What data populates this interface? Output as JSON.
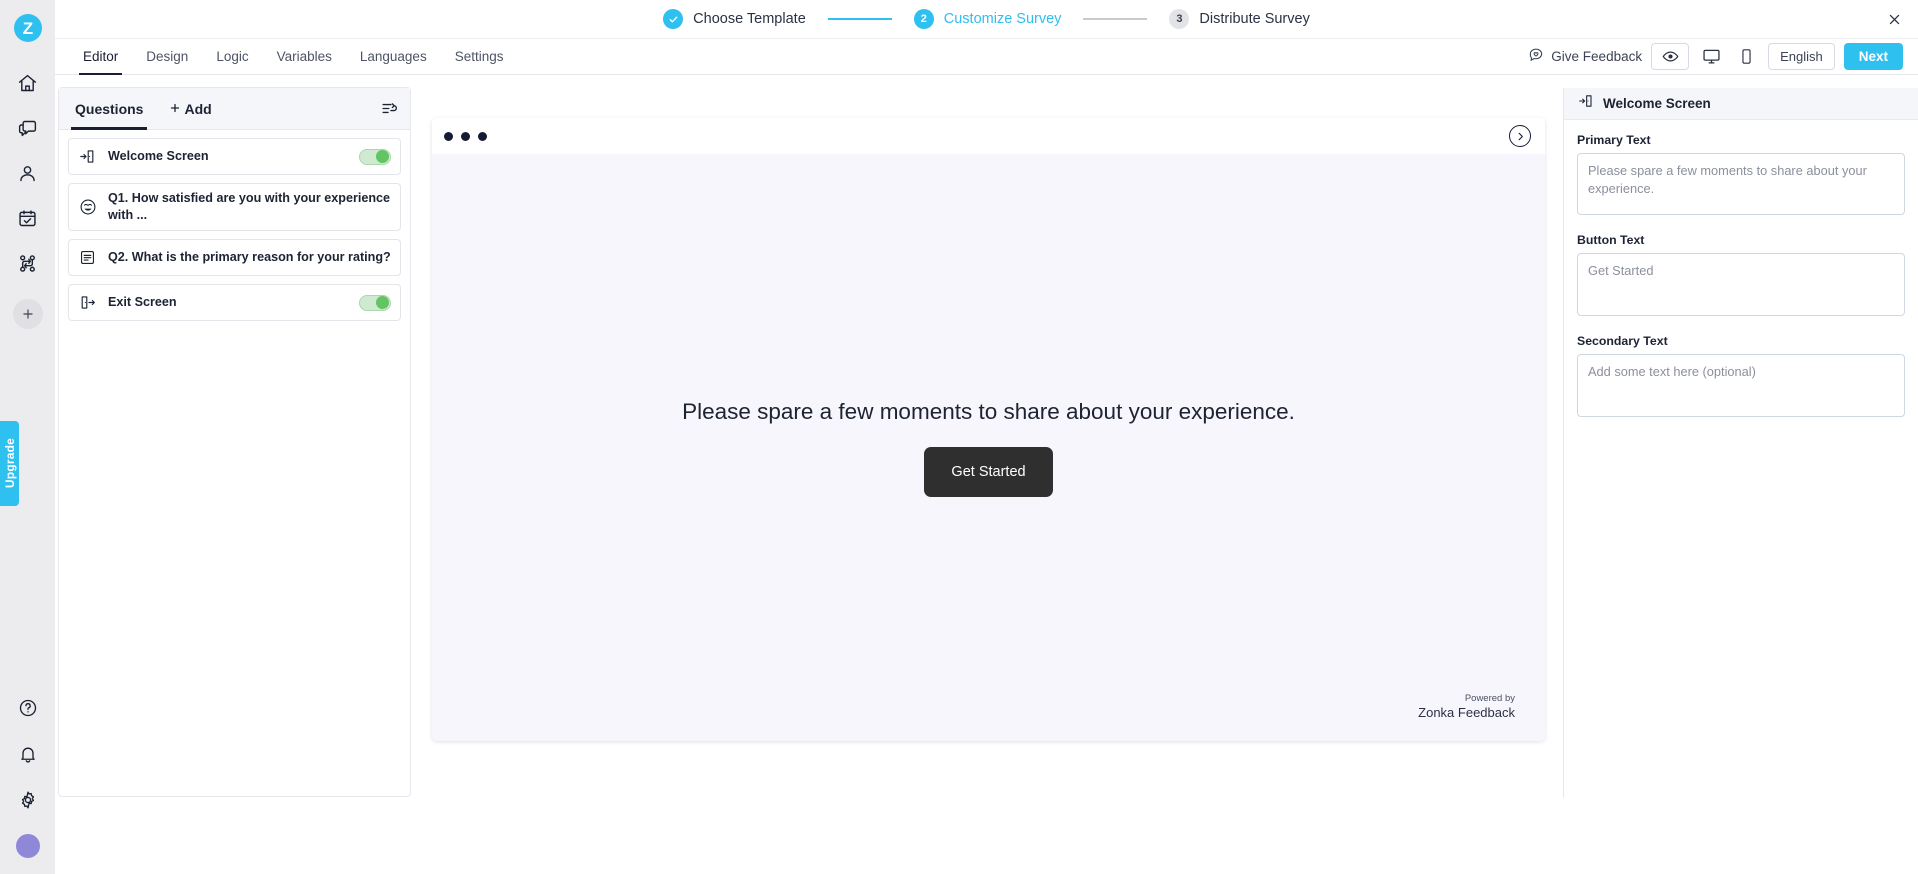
{
  "brand": {
    "logo_letter": "Z",
    "accent": "#2ec0ef",
    "dark": "#1a2032"
  },
  "left_rail": {
    "nav_items": [
      {
        "name": "home-icon",
        "label": "Home"
      },
      {
        "name": "inbox-chat-icon",
        "label": "Inbox"
      },
      {
        "name": "contacts-person-icon",
        "label": "Contacts"
      },
      {
        "name": "tasks-calendar-check-icon",
        "label": "Tasks"
      },
      {
        "name": "workflows-branch-icon",
        "label": "Workflows"
      }
    ],
    "add_button_label": "+",
    "upgrade_label": "Upgrade",
    "bottom_items": [
      {
        "name": "help-question-icon",
        "label": "Help"
      },
      {
        "name": "notifications-bell-icon",
        "label": "Notifications"
      },
      {
        "name": "settings-gear-icon",
        "label": "Settings"
      }
    ]
  },
  "stepper": {
    "steps": [
      {
        "number": "1",
        "label": "Choose Template",
        "state": "done"
      },
      {
        "number": "2",
        "label": "Customize Survey",
        "state": "active"
      },
      {
        "number": "3",
        "label": "Distribute Survey",
        "state": "todo"
      }
    ]
  },
  "toolbar": {
    "tabs": [
      {
        "label": "Editor",
        "active": true
      },
      {
        "label": "Design",
        "active": false
      },
      {
        "label": "Logic",
        "active": false
      },
      {
        "label": "Variables",
        "active": false
      },
      {
        "label": "Languages",
        "active": false
      },
      {
        "label": "Settings",
        "active": false
      }
    ],
    "give_feedback_label": "Give Feedback",
    "language_label": "English",
    "next_label": "Next"
  },
  "questions_panel": {
    "tab_label": "Questions",
    "add_label": "Add",
    "items": [
      {
        "icon": "welcome-screen-icon",
        "label": "Welcome Screen",
        "toggle": true
      },
      {
        "icon": "smiley-rating-icon",
        "label": "Q1. How satisfied are you with your experience with ...",
        "toggle": false
      },
      {
        "icon": "long-text-icon",
        "label": "Q2. What is the primary reason for your rating?",
        "toggle": false
      },
      {
        "icon": "exit-screen-icon",
        "label": "Exit Screen",
        "toggle": true
      }
    ]
  },
  "canvas": {
    "primary_text": "Please spare a few moments to share about your experience.",
    "button_text": "Get Started",
    "powered_by_small": "Powered by",
    "powered_by_big": "Zonka Feedback"
  },
  "right_panel": {
    "header_title": "Welcome Screen",
    "fields": [
      {
        "label": "Primary Text",
        "value": "",
        "placeholder": "Please spare a few moments to share about your experience."
      },
      {
        "label": "Button Text",
        "value": "",
        "placeholder": "Get Started"
      },
      {
        "label": "Secondary Text",
        "value": "",
        "placeholder": "Add some text here (optional)"
      }
    ]
  }
}
